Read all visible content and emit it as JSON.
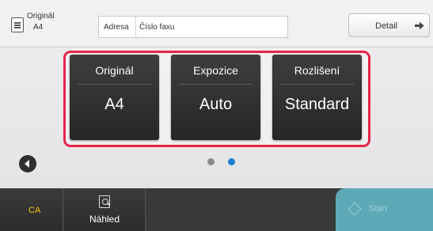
{
  "header": {
    "original_title": "Originál",
    "original_size": "A4",
    "address_label": "Adresa",
    "fax_placeholder": "Číslo faxu",
    "detail_label": "Detail"
  },
  "tiles": [
    {
      "title": "Originál",
      "value": "A4"
    },
    {
      "title": "Expozice",
      "value": "Auto"
    },
    {
      "title": "Rozlišení",
      "value": "Standard"
    }
  ],
  "pager": {
    "pages": 2,
    "current": 2
  },
  "footer": {
    "ca_label": "CA",
    "preview_label": "Náhled",
    "start_label": "Start"
  },
  "colors": {
    "highlight": "#e5254a",
    "ca_text": "#f2c500",
    "start_bg": "#5ea9b8",
    "active_dot": "#1a7fd4"
  }
}
